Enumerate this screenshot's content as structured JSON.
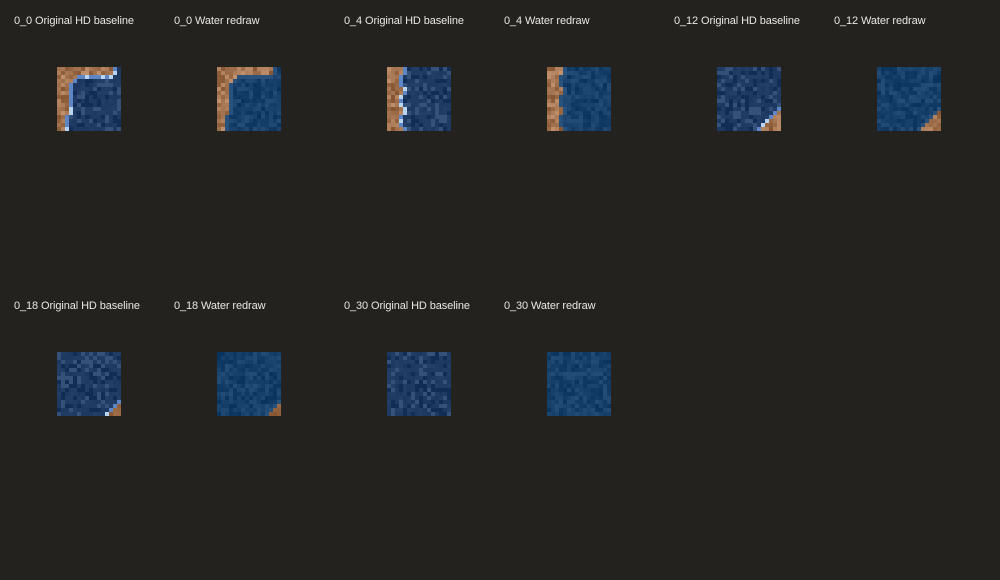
{
  "tiles": [
    {
      "label": "0_0 Original HD baseline",
      "water_color": "#1f3b63",
      "shore_color": "#a47350",
      "variant": "original",
      "shore": "top-left"
    },
    {
      "label": "0_0 Water redraw",
      "water_color": "#16406a",
      "shore_color": "#a47350",
      "variant": "redraw",
      "shore": "top-left"
    },
    {
      "label": "0_4 Original HD baseline",
      "water_color": "#1f3b63",
      "shore_color": "#a47350",
      "variant": "original",
      "shore": "left"
    },
    {
      "label": "0_4 Water redraw",
      "water_color": "#16406a",
      "shore_color": "#a47350",
      "variant": "redraw",
      "shore": "left"
    },
    {
      "label": "0_12 Original HD baseline",
      "water_color": "#1f3b63",
      "shore_color": "#a47350",
      "variant": "original",
      "shore": "bottom-right"
    },
    {
      "label": "0_12 Water redraw",
      "water_color": "#16406a",
      "shore_color": "#a47350",
      "variant": "redraw",
      "shore": "bottom-right"
    },
    {
      "label": "0_18 Original HD baseline",
      "water_color": "#1f3b63",
      "shore_color": "#a47350",
      "variant": "original",
      "shore": "bottom-right-small"
    },
    {
      "label": "0_18 Water redraw",
      "water_color": "#16406a",
      "shore_color": "#a47350",
      "variant": "redraw",
      "shore": "bottom-right-small"
    },
    {
      "label": "0_30 Original HD baseline",
      "water_color": "#1f3b63",
      "shore_color": "#a47350",
      "variant": "original",
      "shore": "none"
    },
    {
      "label": "0_30 Water redraw",
      "water_color": "#16406a",
      "shore_color": "#a47350",
      "variant": "redraw",
      "shore": "none"
    }
  ]
}
